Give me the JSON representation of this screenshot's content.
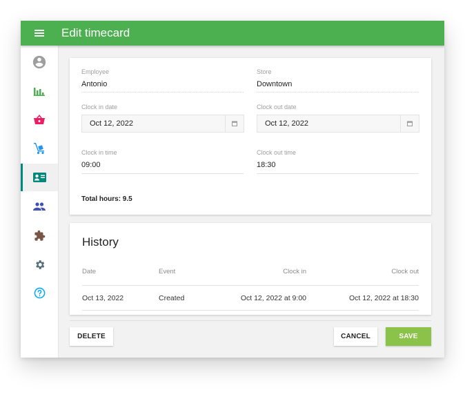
{
  "appbar": {
    "title": "Edit timecard",
    "menu_icon": "hamburger-menu-icon"
  },
  "sidebar": {
    "items": [
      {
        "name": "profile",
        "icon": "account-circle-icon",
        "color": "#9e9e9e",
        "active": false
      },
      {
        "name": "reports",
        "icon": "bar-chart-icon",
        "color": "#4caf50",
        "active": false
      },
      {
        "name": "orders",
        "icon": "shopping-basket-icon",
        "color": "#e91e63",
        "active": false
      },
      {
        "name": "deliveries",
        "icon": "hand-truck-icon",
        "color": "#2196f3",
        "active": false
      },
      {
        "name": "timecards",
        "icon": "id-card-icon",
        "color": "#00897b",
        "active": true
      },
      {
        "name": "users",
        "icon": "people-icon",
        "color": "#3f51b5",
        "active": false
      },
      {
        "name": "extensions",
        "icon": "puzzle-icon",
        "color": "#795548",
        "active": false
      },
      {
        "name": "settings",
        "icon": "gear-icon",
        "color": "#546e7a",
        "active": false
      },
      {
        "name": "help",
        "icon": "help-circle-icon",
        "color": "#03a9f4",
        "active": false
      }
    ]
  },
  "form": {
    "employee": {
      "label": "Employee",
      "value": "Antonio"
    },
    "store": {
      "label": "Store",
      "value": "Downtown"
    },
    "clock_in_date": {
      "label": "Clock in date",
      "value": "Oct 12, 2022"
    },
    "clock_out_date": {
      "label": "Clock out date",
      "value": "Oct 12, 2022"
    },
    "clock_in_time": {
      "label": "Clock in time",
      "value": "09:00"
    },
    "clock_out_time": {
      "label": "Clock out time",
      "value": "18:30"
    },
    "total_hours": "Total hours: 9.5"
  },
  "history": {
    "title": "History",
    "columns": [
      "Date",
      "Event",
      "Clock in",
      "Clock out"
    ],
    "rows": [
      [
        "Oct 13, 2022",
        "Created",
        "Oct 12, 2022 at 9:00",
        "Oct 12, 2022 at 18:30"
      ]
    ]
  },
  "actions": {
    "delete": "DELETE",
    "cancel": "CANCEL",
    "save": "SAVE"
  },
  "colors": {
    "appbar": "#4caf50",
    "save": "#8bc34a",
    "active_indicator": "#00897b"
  }
}
